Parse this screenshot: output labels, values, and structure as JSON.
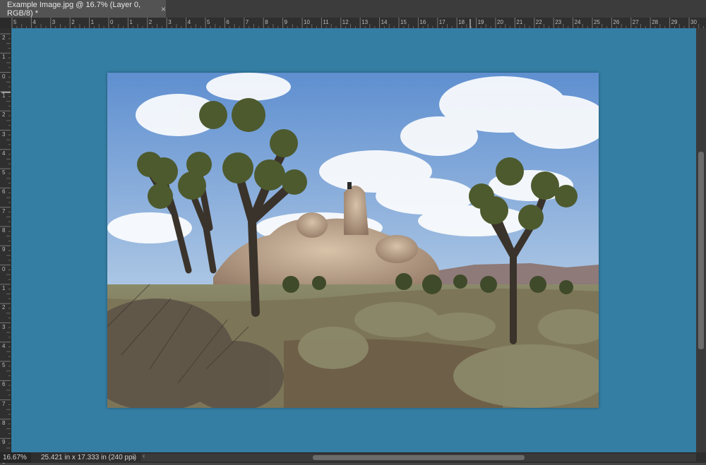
{
  "tab": {
    "title": "Example Image.jpg @ 16.7% (Layer 0, RGB/8) *",
    "close_glyph": "×"
  },
  "ruler_top_labels": [
    "5",
    "4",
    "3",
    "2",
    "1",
    "0",
    "1",
    "2",
    "3",
    "4",
    "5",
    "6",
    "7",
    "8",
    "9",
    "10",
    "11",
    "12",
    "13",
    "14",
    "15",
    "16",
    "17",
    "18",
    "19",
    "20",
    "21",
    "22",
    "23",
    "24",
    "25",
    "26",
    "27",
    "28",
    "29",
    "30"
  ],
  "ruler_left_labels": [
    "2",
    "1",
    "0",
    "1",
    "2",
    "3",
    "4",
    "5",
    "6",
    "7",
    "8",
    "9",
    "0",
    "1",
    "2",
    "3",
    "4",
    "5",
    "6",
    "7",
    "8",
    "9",
    "0"
  ],
  "status": {
    "zoom": "16.67%",
    "doc_info": "25.421 in x 17.333 in (240 ppi)",
    "arrow": "›"
  },
  "colors": {
    "canvas_bg": "#347ea4",
    "ui_dark": "#2f2f2f",
    "tab_bg": "#535353"
  },
  "icons": {
    "tab_close": "close-icon",
    "status_menu": "chevron-right-icon"
  }
}
